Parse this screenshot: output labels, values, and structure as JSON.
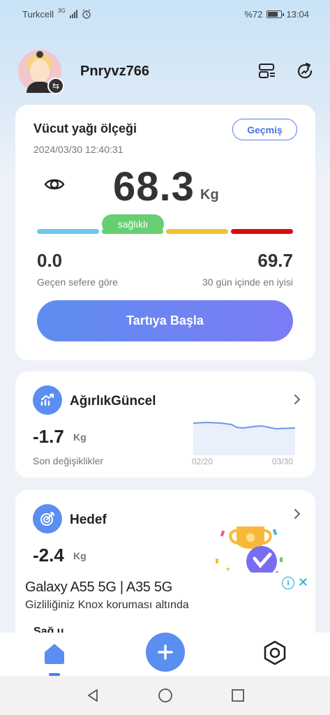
{
  "status_bar": {
    "carrier": "Turkcell",
    "network": "3G",
    "battery": "%72",
    "time": "13:04"
  },
  "header": {
    "username": "Pnryvz766",
    "icons": [
      "avatar",
      "switch-account-icon",
      "device-list-icon",
      "refresh-icon"
    ]
  },
  "scale_card": {
    "title": "Vücut yağı ölçeği",
    "history_label": "Geçmiş",
    "datetime": "2024/03/30 12:40:31",
    "weight": "68.3",
    "unit": "Kg",
    "status": "sağlıklı",
    "status_segment_index": 1,
    "segment_colors": [
      "#6cc6ea",
      "#67cf72",
      "#f2c233",
      "#d80c12"
    ],
    "change_value": "0.0",
    "change_label": "Geçen sefere göre",
    "best_value": "69.7",
    "best_label": "30 gün içinde en iyisi",
    "start_button": "Tartıya Başla"
  },
  "weight_card": {
    "title": "AğırlıkGüncel",
    "value": "-1.7",
    "unit": "Kg",
    "subtitle": "Son değişiklikler",
    "chart_start": "02/20",
    "chart_end": "03/30"
  },
  "goal_card": {
    "title": "Hedef",
    "value": "-2.4",
    "unit": "Kg"
  },
  "ad": {
    "title": "Galaxy A55 5G | A35 5G",
    "subtitle": "Gizliliğiniz Knox koruması altında",
    "peek_text": "Sağ u"
  },
  "colors": {
    "accent": "#5a8ef0",
    "healthy": "#67cf72"
  }
}
